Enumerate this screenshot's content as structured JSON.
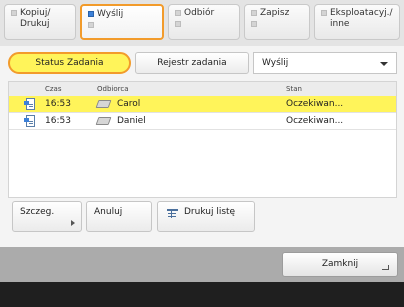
{
  "function_tabs": [
    {
      "label_line1": "Kopiuj/",
      "label_line2": "Drukuj"
    },
    {
      "label_line1": "Wyślij",
      "label_line2": ""
    },
    {
      "label_line1": "Odbiór",
      "label_line2": ""
    },
    {
      "label_line1": "Zapisz",
      "label_line2": ""
    },
    {
      "label_line1": "Eksploatacyj./",
      "label_line2": "inne"
    }
  ],
  "subtabs": {
    "status": "Status Zadania",
    "log": "Rejestr zadania"
  },
  "job_type_select": {
    "value": "Wyślij"
  },
  "columns": {
    "time": "Czas",
    "recipient": "Odbiorca",
    "status": "Stan"
  },
  "jobs": [
    {
      "time": "16:53",
      "recipient": "Carol",
      "status": "Oczekiwan..."
    },
    {
      "time": "16:53",
      "recipient": "Daniel",
      "status": "Oczekiwan..."
    }
  ],
  "buttons": {
    "details": "Szczeg.",
    "cancel": "Anuluj",
    "print_list": "Drukuj listę",
    "close": "Zamknij"
  },
  "colors": {
    "highlight": "#fff45a",
    "focus_ring": "#f29b2b"
  }
}
